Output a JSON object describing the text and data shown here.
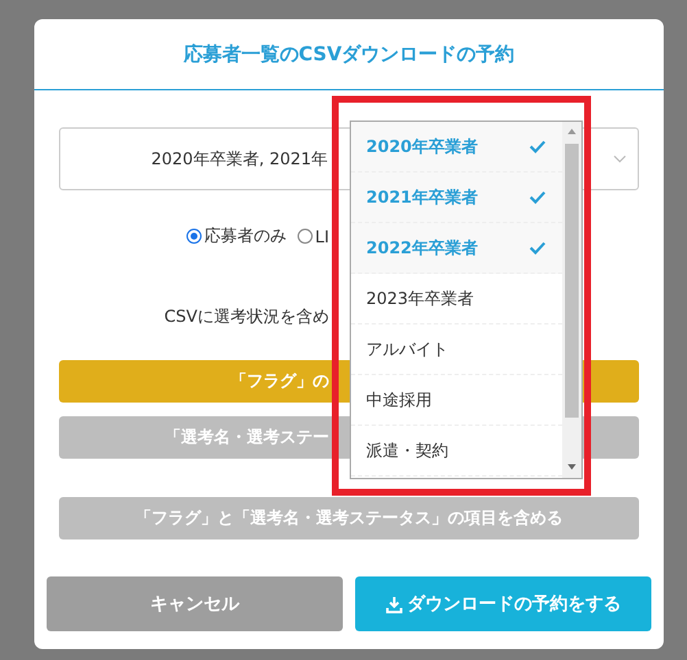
{
  "dialog": {
    "title": "応募者一覧のCSVダウンロードの予約"
  },
  "select": {
    "value": "2020年卒業者, 2021年"
  },
  "radios": [
    {
      "label": "応募者のみ",
      "selected": true
    },
    {
      "label": "LI",
      "selected": false
    }
  ],
  "section_label": "CSVに選考状況を含め",
  "options": [
    {
      "label": "「フラグ」の",
      "selected": true
    },
    {
      "label": "「選考名・選考ステー",
      "selected": false
    },
    {
      "label": "「フラグ」と「選考名・選考ステータス」の項目を含める",
      "selected": false
    }
  ],
  "dropdown": {
    "items": [
      {
        "label": "2020年卒業者",
        "selected": true
      },
      {
        "label": "2021年卒業者",
        "selected": true
      },
      {
        "label": "2022年卒業者",
        "selected": true
      },
      {
        "label": "2023年卒業者",
        "selected": false
      },
      {
        "label": "アルバイト",
        "selected": false
      },
      {
        "label": "中途採用",
        "selected": false
      },
      {
        "label": "派遣・契約",
        "selected": false
      }
    ]
  },
  "buttons": {
    "cancel": "キャンセル",
    "submit": "ダウンロードの予約をする"
  }
}
